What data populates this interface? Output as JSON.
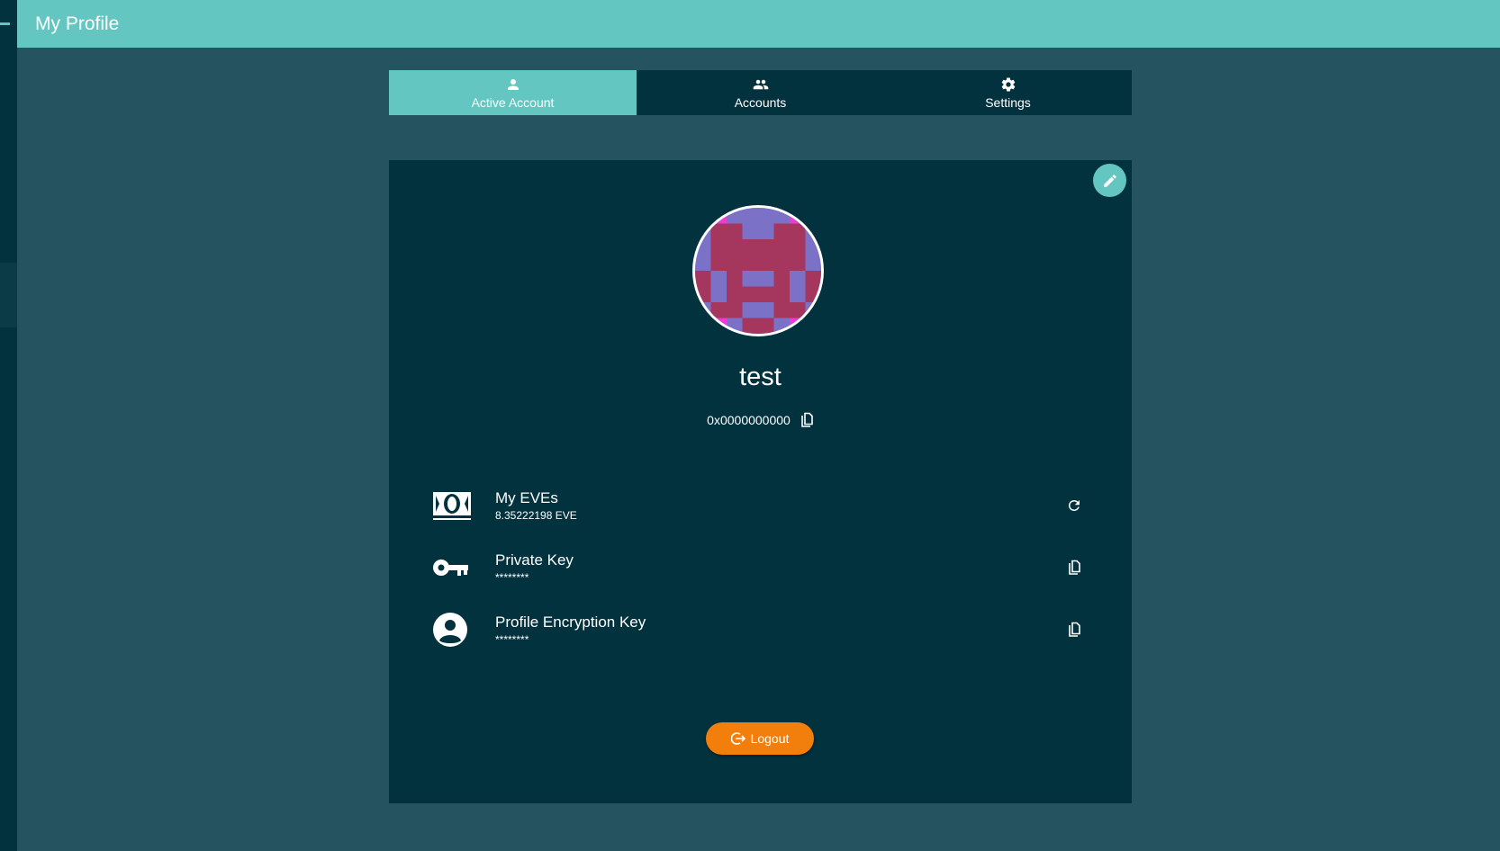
{
  "header": {
    "title": "My Profile"
  },
  "tabs": [
    {
      "label": "Active Account",
      "icon": "person-icon",
      "active": true
    },
    {
      "label": "Accounts",
      "icon": "people-icon",
      "active": false
    },
    {
      "label": "Settings",
      "icon": "gear-icon",
      "active": false
    }
  ],
  "profile": {
    "username": "test",
    "address": "0x0000000000",
    "avatar_colors": {
      "background": "#7b72c8",
      "primary": "#a5375f",
      "accent": "#f03ad8"
    }
  },
  "items": [
    {
      "title": "My EVEs",
      "subtitle": "8.35222198 EVE",
      "icon": "money-icon",
      "action_icon": "refresh-icon"
    },
    {
      "title": "Private Key",
      "subtitle": "********",
      "icon": "key-icon",
      "action_icon": "copy-icon"
    },
    {
      "title": "Profile Encryption Key",
      "subtitle": "********",
      "icon": "account-circle-icon",
      "action_icon": "copy-icon"
    }
  ],
  "logout": {
    "label": "Logout",
    "icon": "logout-icon"
  },
  "colors": {
    "accent": "#63c6c0",
    "background": "#25535f",
    "panel": "#03323f",
    "logout": "#f27f0c"
  }
}
